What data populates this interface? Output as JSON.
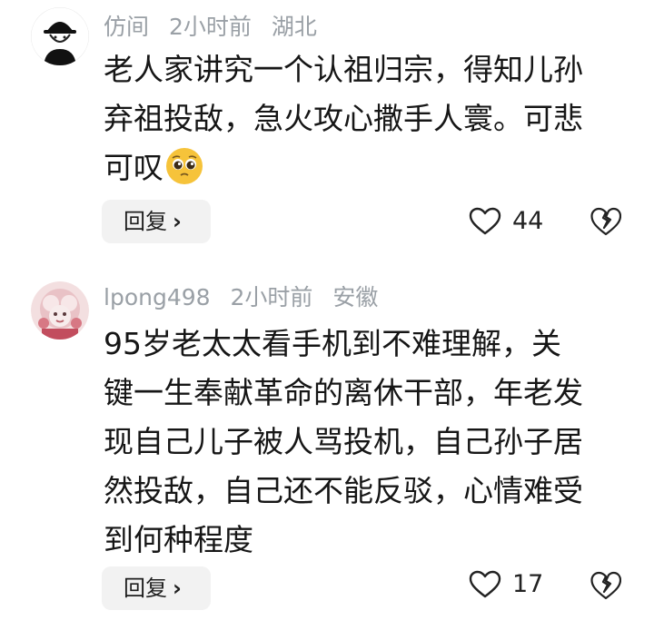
{
  "comments": [
    {
      "username": "仿间",
      "time": "2小时前",
      "location": "湖北",
      "lines": [
        "老人家讲究一个认祖归宗，得知儿孙",
        "弃祖投敌，急火攻心撒手人寰。可悲",
        "可叹"
      ],
      "reply_label": "回复",
      "likes": "44"
    },
    {
      "username": "lpong498",
      "time": "2小时前",
      "location": "安徽",
      "lines": [
        "95岁老太太看手机到不难理解，关",
        "键一生奉献革命的离休干部，年老发",
        "现自己儿子被人骂投机，自己孙子居",
        "然投敌，自己还不能反驳，心情难受",
        "到何种程度"
      ],
      "reply_label": "回复",
      "likes": "17"
    }
  ],
  "colors": {
    "meta": "#9aa0a6",
    "text": "#161616",
    "reply_bg": "#f2f2f2"
  }
}
